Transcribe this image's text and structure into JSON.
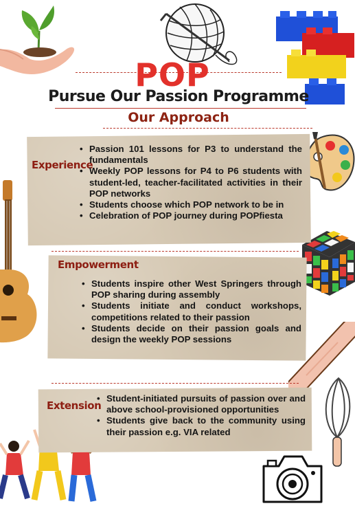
{
  "header": {
    "logo_text": "POP",
    "title": "Pursue Our Passion Programme",
    "subtitle": "Our Approach"
  },
  "sections": [
    {
      "label": "Experience",
      "points": [
        "Passion 101 lessons for P3 to understand the fundamentals",
        "Weekly POP lessons for P4 to P6 students with student-led, teacher-facilitated activities in their POP networks",
        "Students choose which POP network to be in",
        "Celebration of POP journey during POPfiesta"
      ]
    },
    {
      "label": "Empowerment",
      "points": [
        "Students inspire other West Springers through POP sharing during assembly",
        "Students initiate and conduct workshops, competitions related to their passion",
        "Students decide on their passion goals and design the weekly POP sessions"
      ]
    },
    {
      "label": "Extension",
      "points": [
        "Student-initiated pursuits of passion over and above school-provisioned opportunities",
        "Students give back to the community using their passion e.g. VIA related"
      ]
    }
  ],
  "colors": {
    "pop_red": "#e2312b",
    "label_maroon": "#8d1e12",
    "paper": "#d6c9b4",
    "divider": "#b9372a"
  },
  "illustrations": [
    "plant-in-hand-icon",
    "yarn-ball-icon",
    "lego-bricks-icon",
    "paint-palette-icon",
    "guitar-icon",
    "rubiks-cube-icon",
    "rolling-pin-icon",
    "whisk-icon",
    "dancing-people-icon",
    "camera-icon"
  ]
}
